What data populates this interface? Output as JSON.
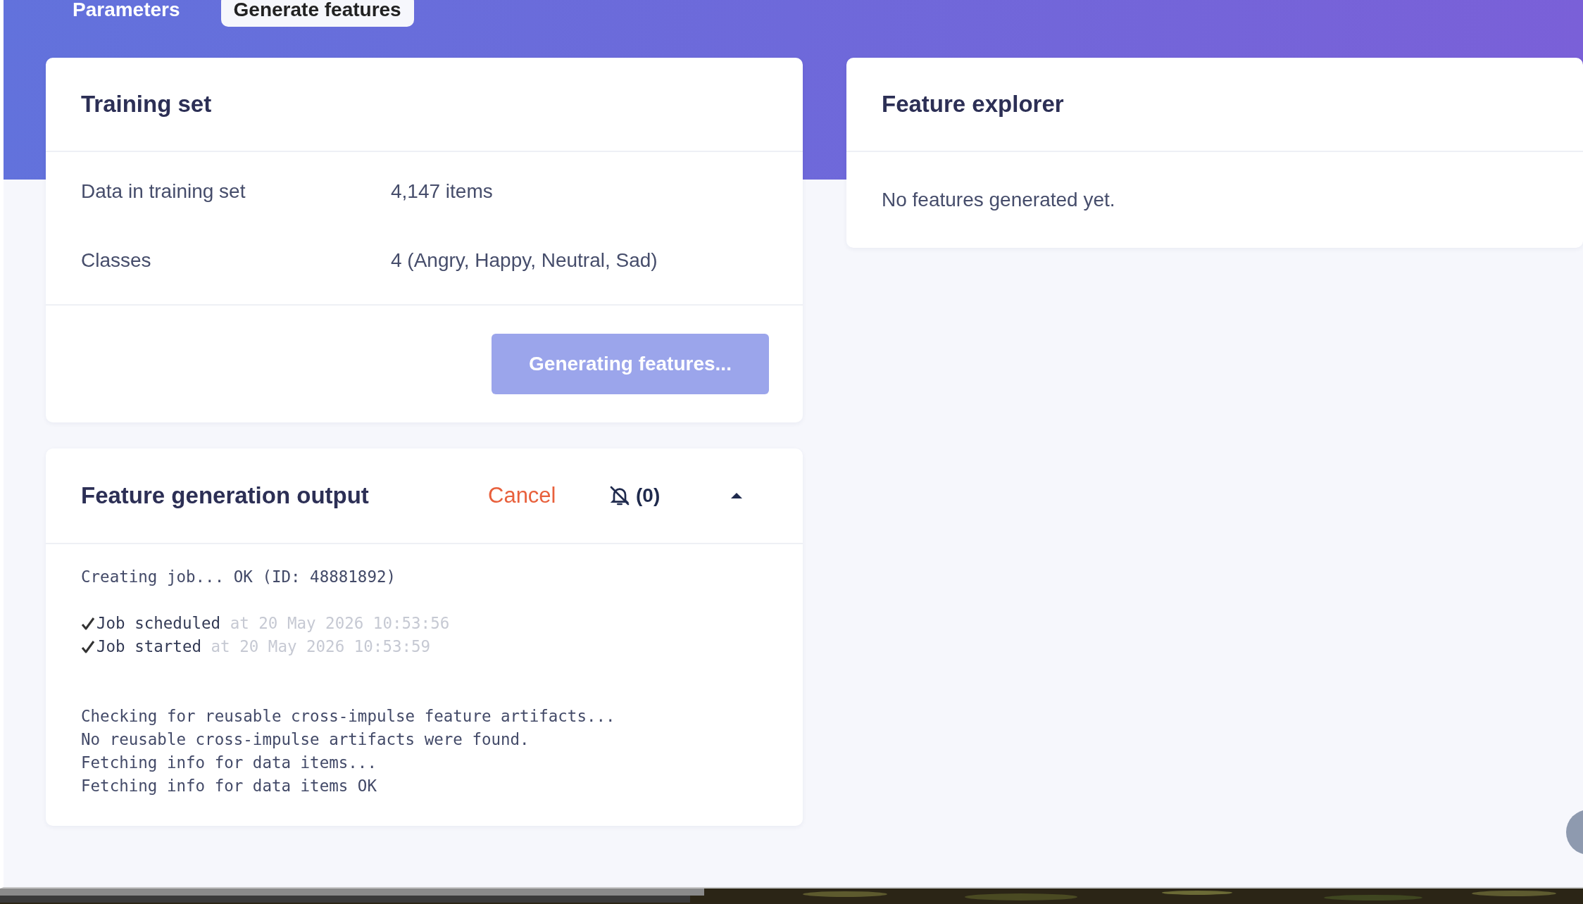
{
  "tabs": [
    {
      "label": "Parameters",
      "selected": false
    },
    {
      "label": "Generate features",
      "selected": true
    }
  ],
  "training_set": {
    "title": "Training set",
    "rows": [
      {
        "label": "Data in training set",
        "value": "4,147 items"
      },
      {
        "label": "Classes",
        "value": "4 (Angry, Happy, Neutral, Sad)"
      }
    ],
    "button": {
      "label": "Generating features...",
      "disabled": true
    }
  },
  "output": {
    "title": "Feature generation output",
    "cancel": "Cancel",
    "notifications": {
      "muted": true,
      "count": "(0)"
    },
    "expanded": true,
    "log": [
      {
        "kind": "text",
        "text": "Creating job... OK (ID: 48881892)"
      },
      {
        "kind": "blank"
      },
      {
        "kind": "check",
        "text": "Job scheduled",
        "time": "at 20 May 2026 10:53:56"
      },
      {
        "kind": "check",
        "text": "Job started",
        "time": "at 20 May 2026 10:53:59"
      },
      {
        "kind": "blank"
      },
      {
        "kind": "blank"
      },
      {
        "kind": "text",
        "text": "Checking for reusable cross-impulse feature artifacts..."
      },
      {
        "kind": "text",
        "text": "No reusable cross-impulse artifacts were found."
      },
      {
        "kind": "text",
        "text": "Fetching info for data items..."
      },
      {
        "kind": "text",
        "text": "Fetching info for data items OK"
      }
    ]
  },
  "feature_explorer": {
    "title": "Feature explorer",
    "message": "No features generated yet."
  }
}
